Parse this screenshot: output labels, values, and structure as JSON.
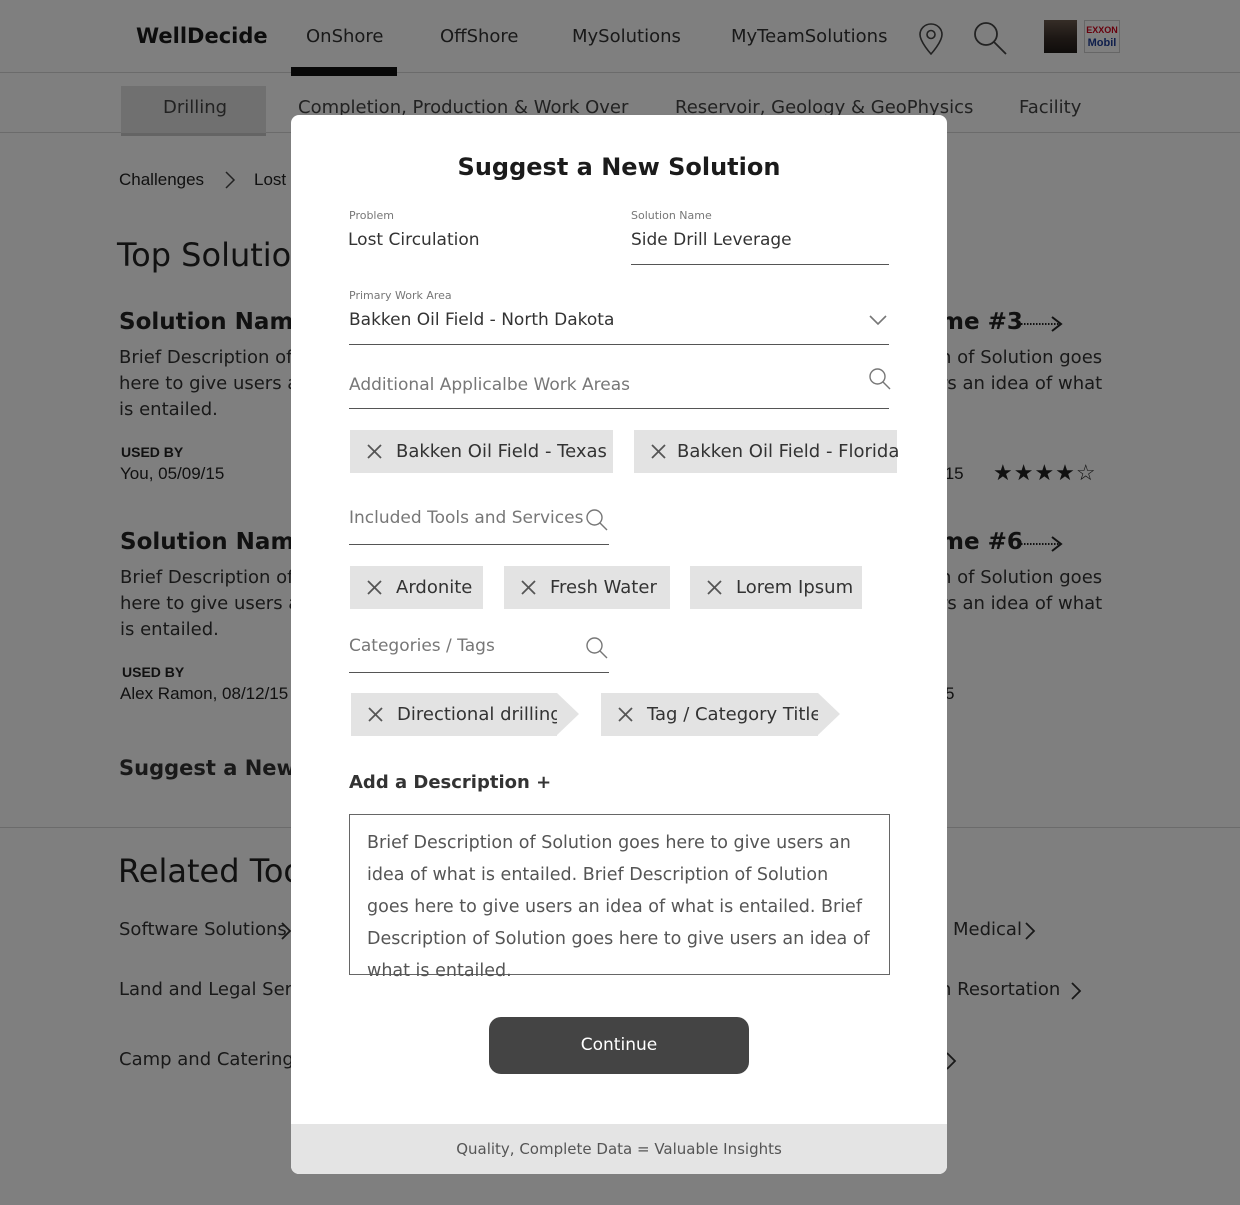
{
  "nav": {
    "brand": "WellDecide",
    "links": [
      "OnShore",
      "OffShore",
      "MySolutions",
      "MyTeamSolutions"
    ],
    "active": "OnShore",
    "icons": [
      "map-pin-icon",
      "search-icon"
    ],
    "logo_lines": [
      "EXXON",
      "Mobil"
    ]
  },
  "subnav": {
    "items": [
      "Drilling",
      "Completion, Production & Work Over",
      "Reservoir, Geology & GeoPhysics",
      "Facility"
    ],
    "active": "Drilling"
  },
  "background": {
    "breadcrumb": [
      "Challenges",
      "Lost"
    ],
    "top_heading": "Top Solution",
    "solutions": [
      {
        "title": "Solution Name",
        "desc": [
          "Brief Description of",
          "here to give users a",
          "is entailed."
        ],
        "used_by_label": "USED BY",
        "used_by": "You, 05/09/15"
      },
      {
        "title": "Solution Name",
        "desc": [
          "Brief Description of",
          "here to give users a",
          "is entailed."
        ],
        "used_by_label": "USED BY",
        "used_by": "Alex Ramon, 08/12/15"
      }
    ],
    "right_solutions": [
      {
        "title": "me #3",
        "desc": [
          "n of Solution goes",
          "rs an idea of what"
        ],
        "used_by": "/15",
        "rating": "★★★★☆"
      },
      {
        "title": "me #6",
        "desc": [
          "n of Solution goes",
          "rs an idea of what"
        ],
        "used_by": "5"
      }
    ],
    "suggest_link": "Suggest a New S",
    "related_heading": "Related Too",
    "related_links_left": [
      "Software Solutions",
      "Land and Legal Servic",
      "Camp and Catering"
    ],
    "related_links_right": [
      "Medical",
      "n Resortation"
    ]
  },
  "modal": {
    "title": "Suggest a New Solution",
    "problem_label": "Problem",
    "problem_value": "Lost Circulation",
    "solution_name_label": "Solution Name",
    "solution_name_value": "Side Drill Leverage",
    "primary_work_area_label": "Primary Work Area",
    "primary_work_area_value": "Bakken Oil Field - North Dakota",
    "additional_work_areas_placeholder": "Additional Applicalbe Work Areas",
    "work_area_chips": [
      "Bakken Oil Field - Texas",
      "Bakken Oil Field - Florida"
    ],
    "tools_placeholder": "Included Tools and Services",
    "tool_chips": [
      "Ardonite",
      "Fresh Water",
      "Lorem Ipsum"
    ],
    "categories_placeholder": "Categories / Tags",
    "tags": [
      "Directional drilling",
      "Tag / Category Title"
    ],
    "add_description_label": "Add a Description +",
    "description": "Brief Description of Solution goes here to give users an idea of what is entailed. Brief Description of Solution goes here to give users an idea of what is entailed. Brief Description of Solution goes here to give users an idea of what is entailed.",
    "continue_label": "Continue",
    "footer": "Quality, Complete Data = Valuable Insights"
  }
}
